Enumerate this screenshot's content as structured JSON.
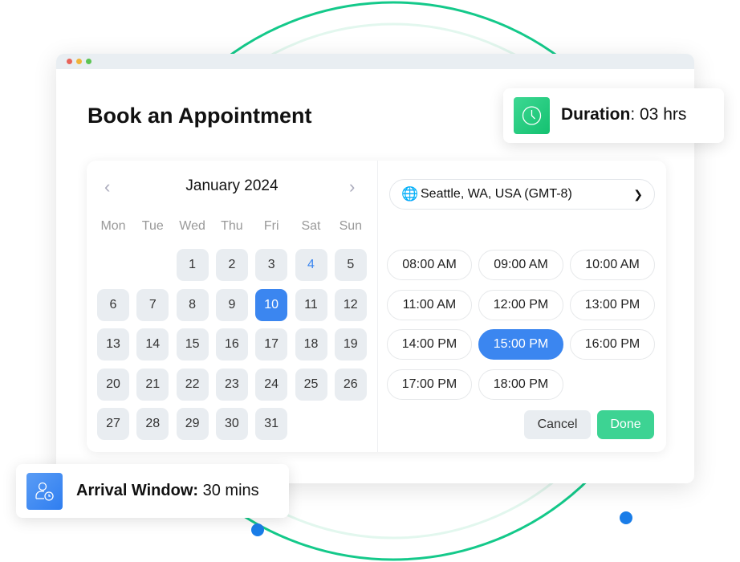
{
  "window": {
    "title": "Book an Appointment"
  },
  "calendar": {
    "month_label": "January 2024",
    "prev_icon": "chevron-left-icon",
    "next_icon": "chevron-right-icon",
    "weekdays": [
      "Mon",
      "Tue",
      "Wed",
      "Thu",
      "Fri",
      "Sat",
      "Sun"
    ],
    "first_weekday_index": 2,
    "days_in_month": 31,
    "selected_day": 10,
    "highlighted_day": 4
  },
  "timezone": {
    "value": "Seattle, WA, USA (GMT-8)",
    "icon": "globe-icon"
  },
  "slots": [
    {
      "label": "08:00 AM"
    },
    {
      "label": "09:00 AM"
    },
    {
      "label": "10:00 AM"
    },
    {
      "label": "11:00 AM"
    },
    {
      "label": "12:00 PM"
    },
    {
      "label": "13:00 PM"
    },
    {
      "label": "14:00 PM"
    },
    {
      "label": "15:00 PM",
      "selected": true
    },
    {
      "label": "16:00 PM"
    },
    {
      "label": "17:00 PM"
    },
    {
      "label": "18:00 PM"
    }
  ],
  "actions": {
    "cancel": "Cancel",
    "done": "Done"
  },
  "duration": {
    "label": "Duration",
    "value": ": 03 hrs"
  },
  "arrival": {
    "label": "Arrival Window:",
    "value": " 30 mins"
  },
  "colors": {
    "accent": "#3b86f0",
    "done": "#3dd393",
    "arc": "#14c98a"
  }
}
